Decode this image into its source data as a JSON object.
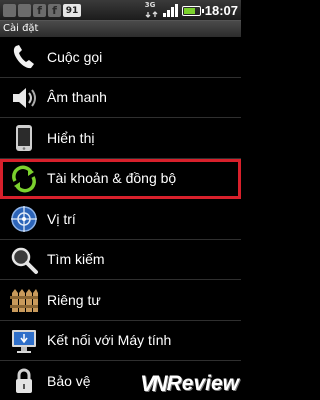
{
  "status_bar": {
    "time": "18:07",
    "network": "3G",
    "notification_badge": "91",
    "battery_level": 0.75
  },
  "title": "Cài đặt",
  "settings": [
    {
      "label": "Cuộc gọi",
      "icon": "phone-icon"
    },
    {
      "label": "Âm thanh",
      "icon": "speaker-icon"
    },
    {
      "label": "Hiển thị",
      "icon": "phone-display-icon"
    },
    {
      "label": "Tài khoản & đồng bộ",
      "icon": "sync-icon",
      "selected": true
    },
    {
      "label": "Vị trí",
      "icon": "location-icon"
    },
    {
      "label": "Tìm kiếm",
      "icon": "magnifier-icon"
    },
    {
      "label": "Riêng tư",
      "icon": "fence-icon"
    },
    {
      "label": "Kết nối với Máy tính",
      "icon": "computer-icon"
    },
    {
      "label": "Bảo vệ",
      "icon": "lock-icon"
    }
  ],
  "watermark": {
    "logo": "VN",
    "text": "Review"
  },
  "colors": {
    "highlight": "#d8202b",
    "sync_green": "#7bd12d"
  }
}
